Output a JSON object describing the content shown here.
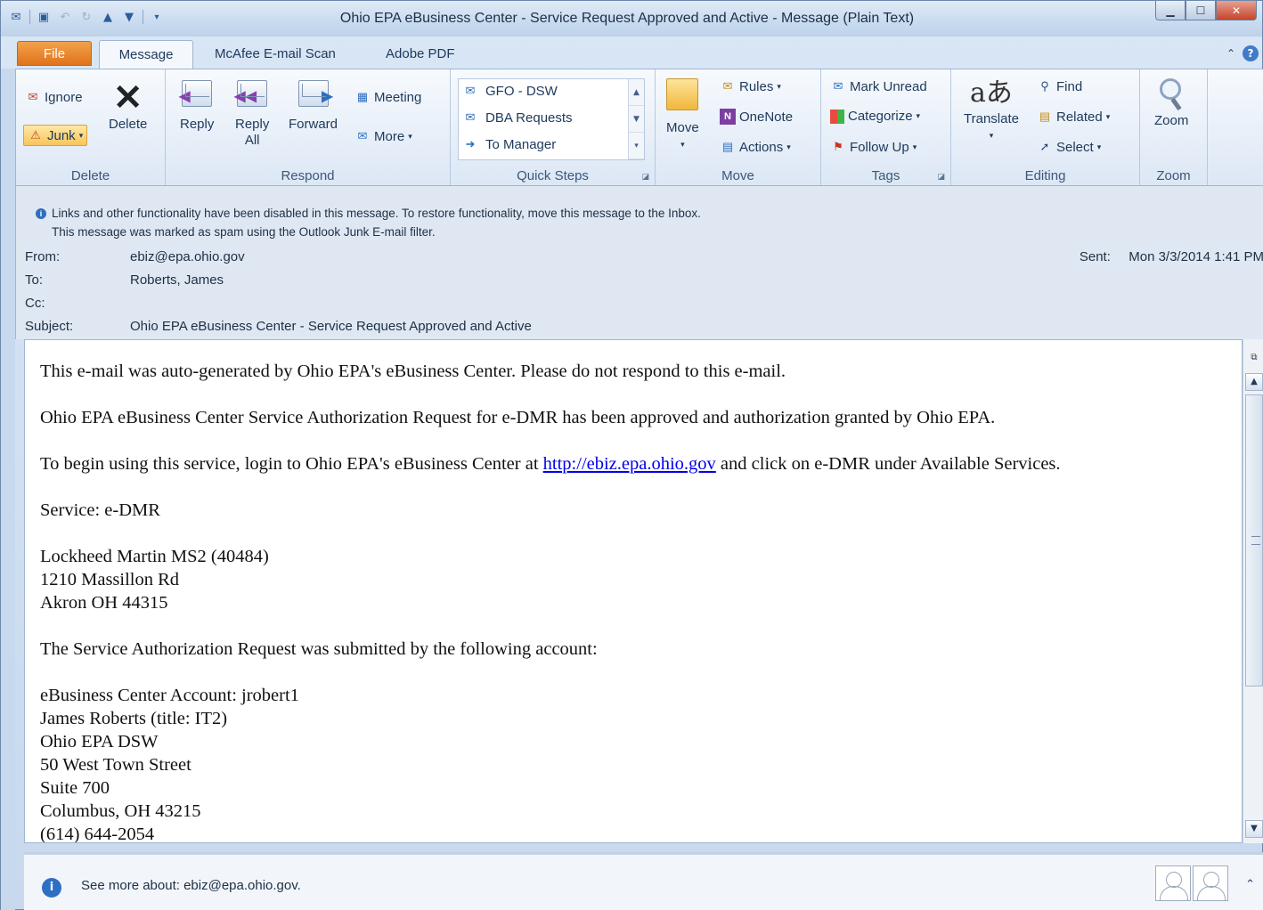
{
  "window": {
    "title": "Ohio EPA eBusiness Center - Service Request Approved and Active - Message (Plain Text)"
  },
  "tabs": [
    {
      "label": "File"
    },
    {
      "label": "Message"
    },
    {
      "label": "McAfee E-mail Scan"
    },
    {
      "label": "Adobe PDF"
    }
  ],
  "ribbon": {
    "delete": {
      "label": "Delete",
      "ignore": "Ignore",
      "junk": "Junk",
      "delete_btn": "Delete"
    },
    "respond": {
      "label": "Respond",
      "reply": "Reply",
      "reply_all_1": "Reply",
      "reply_all_2": "All",
      "forward": "Forward",
      "meeting": "Meeting",
      "more": "More"
    },
    "quick_steps": {
      "label": "Quick Steps",
      "items": [
        "GFO - DSW",
        "DBA Requests",
        "To Manager"
      ]
    },
    "move": {
      "label": "Move",
      "move_btn": "Move",
      "rules": "Rules",
      "onenote": "OneNote",
      "actions": "Actions"
    },
    "tags": {
      "label": "Tags",
      "mark_unread": "Mark Unread",
      "categorize": "Categorize",
      "follow_up": "Follow Up"
    },
    "editing": {
      "label": "Editing",
      "translate": "Translate",
      "find": "Find",
      "related": "Related",
      "select": "Select"
    },
    "zoom": {
      "label": "Zoom",
      "zoom_btn": "Zoom"
    }
  },
  "notice": {
    "line1": "Links and other functionality have been disabled in this message. To restore functionality, move this message to the Inbox.",
    "line2": "This message was marked as spam using the Outlook Junk E-mail filter."
  },
  "header": {
    "from_label": "From:",
    "from_value": "ebiz@epa.ohio.gov",
    "to_label": "To:",
    "to_value": "Roberts, James",
    "cc_label": "Cc:",
    "cc_value": "",
    "subject_label": "Subject:",
    "subject_value": "Ohio EPA eBusiness Center - Service Request Approved and Active",
    "sent_label": "Sent:",
    "sent_value": "Mon 3/3/2014 1:41 PM"
  },
  "body": {
    "p1": "This e-mail was auto-generated by Ohio EPA's eBusiness Center.  Please do not respond to this e-mail.",
    "p2": "Ohio EPA eBusiness Center Service Authorization Request for e-DMR has been approved and authorization granted by Ohio EPA.",
    "p3_before": "To begin using this service, login to Ohio EPA's eBusiness Center at ",
    "p3_link": "http://ebiz.epa.ohio.gov",
    "p3_after": " and click on e-DMR under Available Services.",
    "p4": "Service: e-DMR",
    "addr1": "Lockheed Martin MS2 (40484)",
    "addr2": "1210 Massillon Rd",
    "addr3": "Akron OH  44315",
    "p6": "The Service Authorization Request was submitted by the following account:",
    "acct1": "eBusiness Center Account: jrobert1",
    "acct2": "James Roberts (title: IT2)",
    "acct3": "Ohio EPA DSW",
    "acct4": "50 West Town Street",
    "acct5": "Suite 700",
    "acct6": "Columbus,  OH 43215",
    "acct7": "(614) 644-2054"
  },
  "people_pane": {
    "text": "See more about: ebiz@epa.ohio.gov."
  }
}
